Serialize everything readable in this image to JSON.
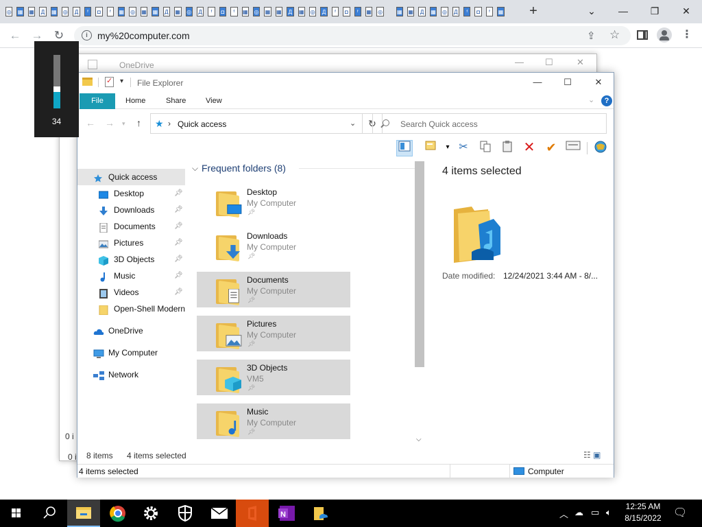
{
  "browser": {
    "url": "my%20computer.com",
    "new_tab": "+",
    "tab_favicons": [
      "1",
      "2",
      "3",
      "4",
      "5",
      "6",
      "7",
      "8",
      "9",
      "10",
      "11",
      "12",
      "13",
      "14",
      "15",
      "16",
      "17",
      "18",
      "19",
      "20",
      "21",
      "22",
      "23",
      "24",
      "25",
      "26",
      "27",
      "28",
      "29",
      "30",
      "31",
      "32",
      "33",
      "34",
      "35",
      "36",
      "37",
      "38",
      "39",
      "40",
      "41",
      "42",
      "43",
      "44"
    ]
  },
  "volume_osd": {
    "value": "34",
    "level_fraction": 0.34,
    "accent": "#0fa6c6"
  },
  "background_window": {
    "title": "OneDrive",
    "frag1": "0 i",
    "frag2": "0 ite"
  },
  "explorer": {
    "title": "File Explorer",
    "ribbon_tabs": [
      "File",
      "Home",
      "Share",
      "View"
    ],
    "address": {
      "location": "Quick access"
    },
    "search": {
      "placeholder": "Search Quick access"
    },
    "nav": [
      {
        "label": "Quick access",
        "icon": "star-icon",
        "pinned": false
      },
      {
        "label": "Desktop",
        "icon": "desktop-icon",
        "pinned": true
      },
      {
        "label": "Downloads",
        "icon": "download-icon",
        "pinned": true
      },
      {
        "label": "Documents",
        "icon": "document-icon",
        "pinned": true
      },
      {
        "label": "Pictures",
        "icon": "picture-icon",
        "pinned": true
      },
      {
        "label": "3D Objects",
        "icon": "cube-icon",
        "pinned": true
      },
      {
        "label": "Music",
        "icon": "music-icon",
        "pinned": true
      },
      {
        "label": "Videos",
        "icon": "video-icon",
        "pinned": true
      },
      {
        "label": "Open-Shell Modern",
        "icon": "folder-icon",
        "pinned": false
      },
      {
        "label": "OneDrive",
        "icon": "cloud-icon",
        "pinned": false
      },
      {
        "label": "My Computer",
        "icon": "computer-icon",
        "pinned": false
      },
      {
        "label": "Network",
        "icon": "network-icon",
        "pinned": false
      }
    ],
    "group": {
      "title": "Frequent folders (8)"
    },
    "folders": [
      {
        "name": "Desktop",
        "location": "My Computer",
        "selected": false
      },
      {
        "name": "Downloads",
        "location": "My Computer",
        "selected": false
      },
      {
        "name": "Documents",
        "location": "My Computer",
        "selected": true
      },
      {
        "name": "Pictures",
        "location": "My Computer",
        "selected": true
      },
      {
        "name": "3D Objects",
        "location": "VM5",
        "selected": true
      },
      {
        "name": "Music",
        "location": "My Computer",
        "selected": true
      }
    ],
    "details": {
      "title": "4 items selected",
      "date_label": "Date modified:",
      "date_value": "12/24/2021 3:44 AM - 8/..."
    },
    "status": {
      "count": "8 items",
      "selected": "4 items selected",
      "bottom_selected": "4 items selected",
      "bottom_location": "Computer"
    }
  },
  "taskbar": {
    "time": "12:25 AM",
    "date": "8/15/2022"
  }
}
